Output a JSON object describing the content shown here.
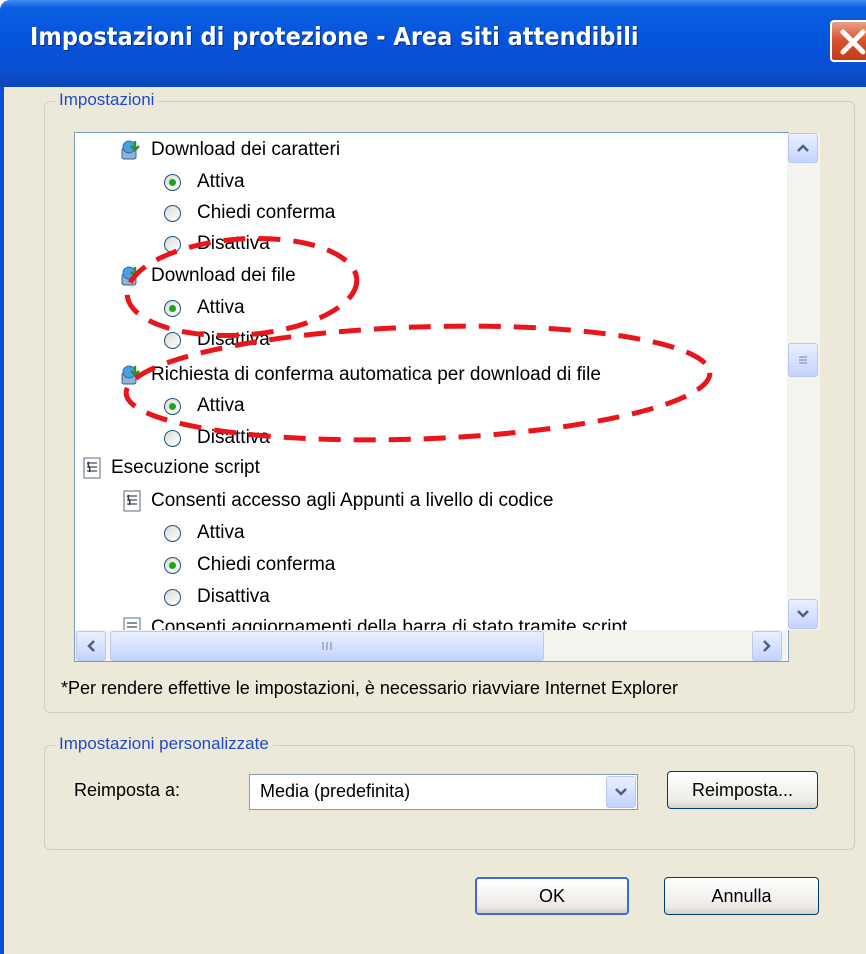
{
  "window": {
    "title": "Impostazioni di protezione - Area siti attendibili",
    "close_icon": "close-icon"
  },
  "settings_group": {
    "label": "Impostazioni",
    "items": [
      {
        "type": "category",
        "icon": "download-icon",
        "text": "Download dei caratteri"
      },
      {
        "type": "radio",
        "text": "Attiva",
        "checked": true
      },
      {
        "type": "radio",
        "text": "Chiedi conferma",
        "checked": false
      },
      {
        "type": "radio",
        "text": "Disattiva",
        "checked": false
      },
      {
        "type": "category",
        "icon": "download-icon",
        "text": "Download dei file"
      },
      {
        "type": "radio",
        "text": "Attiva",
        "checked": true
      },
      {
        "type": "radio",
        "text": "Disattiva",
        "checked": false
      },
      {
        "type": "category",
        "icon": "download-icon",
        "text": "Richiesta di conferma automatica per download di file"
      },
      {
        "type": "radio",
        "text": "Attiva",
        "checked": true
      },
      {
        "type": "radio",
        "text": "Disattiva",
        "checked": false
      },
      {
        "type": "group",
        "icon": "script-icon",
        "text": "Esecuzione script"
      },
      {
        "type": "category",
        "icon": "script-icon",
        "text": "Consenti accesso agli Appunti a livello di codice"
      },
      {
        "type": "radio",
        "text": "Attiva",
        "checked": false
      },
      {
        "type": "radio",
        "text": "Chiedi conferma",
        "checked": true
      },
      {
        "type": "radio",
        "text": "Disattiva",
        "checked": false
      },
      {
        "type": "category",
        "icon": "script-icon",
        "text": "Consenti aggiornamenti della barra di stato tramite script"
      }
    ],
    "note": "*Per rendere effettive le impostazioni, è necessario riavviare Internet Explorer"
  },
  "custom_group": {
    "label": "Impostazioni personalizzate",
    "reset_label": "Reimposta a:",
    "reset_value": "Media (predefinita)",
    "reset_button": "Reimposta..."
  },
  "buttons": {
    "ok": "OK",
    "cancel": "Annulla"
  },
  "annotation_color": "#e8151b"
}
